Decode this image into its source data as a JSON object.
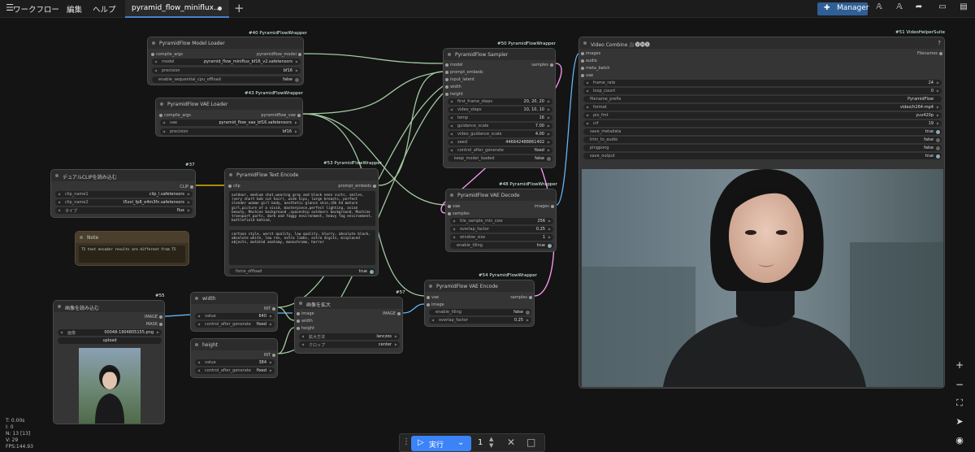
{
  "menu": {
    "workflow": "ワークフロー",
    "edit": "編集",
    "help": "ヘルプ"
  },
  "tab": {
    "title": "pyramid_flow_miniflux...",
    "add": "+"
  },
  "toolbar": {
    "manager": "Manager"
  },
  "nodes": {
    "model_loader": {
      "badge": "#40 PyramidFlowWrapper",
      "title": "PyramidFlow Model Loader",
      "in": "compile_args",
      "out": "pyramidflow_model",
      "w": [
        {
          "l": "model",
          "v": "pyramid_flow_miniflux_bf16_v2.safetensors"
        },
        {
          "l": "precision",
          "v": "bf16"
        },
        {
          "l": "enable_sequential_cpu_offload",
          "v": "false"
        }
      ]
    },
    "vae_loader": {
      "badge": "#43 PyramidFlowWrapper",
      "title": "PyramidFlow VAE Loader",
      "in": "compile_args",
      "out": "pyramidflow_vae",
      "w": [
        {
          "l": "vae",
          "v": "pyramid_flow_vae_bf16.safetensors"
        },
        {
          "l": "precision",
          "v": "bf16"
        }
      ]
    },
    "dual_clip": {
      "badge": "#37",
      "title": "デュアルCLIPを読み込む",
      "out": "CLIP",
      "w": [
        {
          "l": "clip_name1",
          "v": "clip_l.safetensors"
        },
        {
          "l": "clip_name2",
          "v": "t5xxl_fp8_e4m3fn.safetensors"
        },
        {
          "l": "タイプ",
          "v": "flux"
        }
      ]
    },
    "note": {
      "title": "Note",
      "text": "T5 text encoder results are different from T5"
    },
    "text_encode": {
      "badge": "#53 PyramidFlowWrapper",
      "title": "PyramidFlow Text Encode",
      "in": "clip",
      "out": "prompt_embeds",
      "pos": "outdoor, medium shot,wearing gray and black neon suits, smiles, (very short bob cut hair), wide hips, large breasts, perfect slender woman girl body, aesthetic glance skin,(8k hd mature girl,picture of a vivid, masterpiece,perfect lighting, asian beauty, Machine background ,spaceship outdoors background, Machine transport ports, dark and foggy environment, heavy fog environment, battlefield behind,",
      "neg": "cartoon style, worst quality, low quality, blurry, absolute black, absolute white, low res, extra limbs, extra digits, misplaced objects, mutated anatomy, monochrome, horror",
      "w": [
        {
          "l": "force_offload",
          "v": "true"
        }
      ]
    },
    "sampler": {
      "badge": "#50 PyramidFlowWrapper",
      "title": "PyramidFlow Sampler",
      "in": [
        "model",
        "prompt_embeds",
        "input_latent",
        "width",
        "height"
      ],
      "out": "samples",
      "w": [
        {
          "l": "first_frame_steps",
          "v": "20, 20, 20"
        },
        {
          "l": "video_steps",
          "v": "10, 10, 10"
        },
        {
          "l": "temp",
          "v": "16"
        },
        {
          "l": "guidance_scale",
          "v": "7.00"
        },
        {
          "l": "video_guidance_scale",
          "v": "4.00"
        },
        {
          "l": "seed",
          "v": "446642488861402"
        },
        {
          "l": "control_after_generate",
          "v": "fixed"
        },
        {
          "l": "keep_model_loaded",
          "v": "false"
        }
      ]
    },
    "vae_decode": {
      "badge": "#48 PyramidFlowWrapper",
      "title": "PyramidFlow VAE Decode",
      "in": [
        "vae",
        "samples"
      ],
      "out": "images",
      "w": [
        {
          "l": "tile_sample_min_size",
          "v": "256"
        },
        {
          "l": "overlap_factor",
          "v": "0.25"
        },
        {
          "l": "window_size",
          "v": "1"
        },
        {
          "l": "enable_tiling",
          "v": "true"
        }
      ]
    },
    "vae_encode": {
      "badge": "#54 PyramidFlowWrapper",
      "title": "PyramidFlow VAE Encode",
      "in": [
        "vae",
        "image"
      ],
      "out": "samples",
      "w": [
        {
          "l": "enable_tiling",
          "v": "false"
        },
        {
          "l": "overlap_factor",
          "v": "0.25"
        }
      ]
    },
    "load_image": {
      "badge": "#55",
      "title": "画像を読み込む",
      "out": [
        "IMAGE",
        "MASK"
      ],
      "w": [
        {
          "l": "画像",
          "v": "00048-1904805155.png"
        }
      ],
      "upload": "upload"
    },
    "width": {
      "title": "width",
      "out": "INT",
      "w": [
        {
          "l": "value",
          "v": "640"
        },
        {
          "l": "control_after_generate",
          "v": "fixed"
        }
      ]
    },
    "height": {
      "title": "height",
      "out": "INT",
      "w": [
        {
          "l": "value",
          "v": "384"
        },
        {
          "l": "control_after_generate",
          "v": "fixed"
        }
      ]
    },
    "upscale": {
      "badge": "#57",
      "title": "画像を拡大",
      "in": [
        "image",
        "width",
        "height"
      ],
      "out": "IMAGE",
      "w": [
        {
          "l": "拡大方法",
          "v": "lanczos"
        },
        {
          "l": "クロップ",
          "v": "center"
        }
      ]
    },
    "video_combine": {
      "badge": "#51 VideoHelperSuite",
      "title": "Video Combine 🎥🅥🅗🅢",
      "in": [
        "images",
        "audio",
        "meta_batch",
        "vae"
      ],
      "out": "Filenames",
      "help": "?",
      "w": [
        {
          "l": "frame_rate",
          "v": "24"
        },
        {
          "l": "loop_count",
          "v": "0"
        },
        {
          "l": "filename_prefix",
          "v": "PyramidFlow"
        },
        {
          "l": "format",
          "v": "video/h264-mp4"
        },
        {
          "l": "pix_fmt",
          "v": "yuv420p"
        },
        {
          "l": "crf",
          "v": "19"
        },
        {
          "l": "save_metadata",
          "v": "true"
        },
        {
          "l": "trim_to_audio",
          "v": "false"
        },
        {
          "l": "pingpong",
          "v": "false"
        },
        {
          "l": "save_output",
          "v": "true"
        }
      ]
    }
  },
  "stats": [
    "T: 0.00s",
    "I: 0",
    "N: 13 [13]",
    "V: 29",
    "FPS:144.93"
  ],
  "run": {
    "label": "実行",
    "count": "1"
  },
  "colors": {
    "accent": "#3b83f6",
    "wire_vae": "#e06c6c",
    "wire_latent": "#ff9cf9",
    "wire_image": "#64b5f6",
    "wire_clip": "#ffd500",
    "wire_default": "#a0c8a0"
  }
}
